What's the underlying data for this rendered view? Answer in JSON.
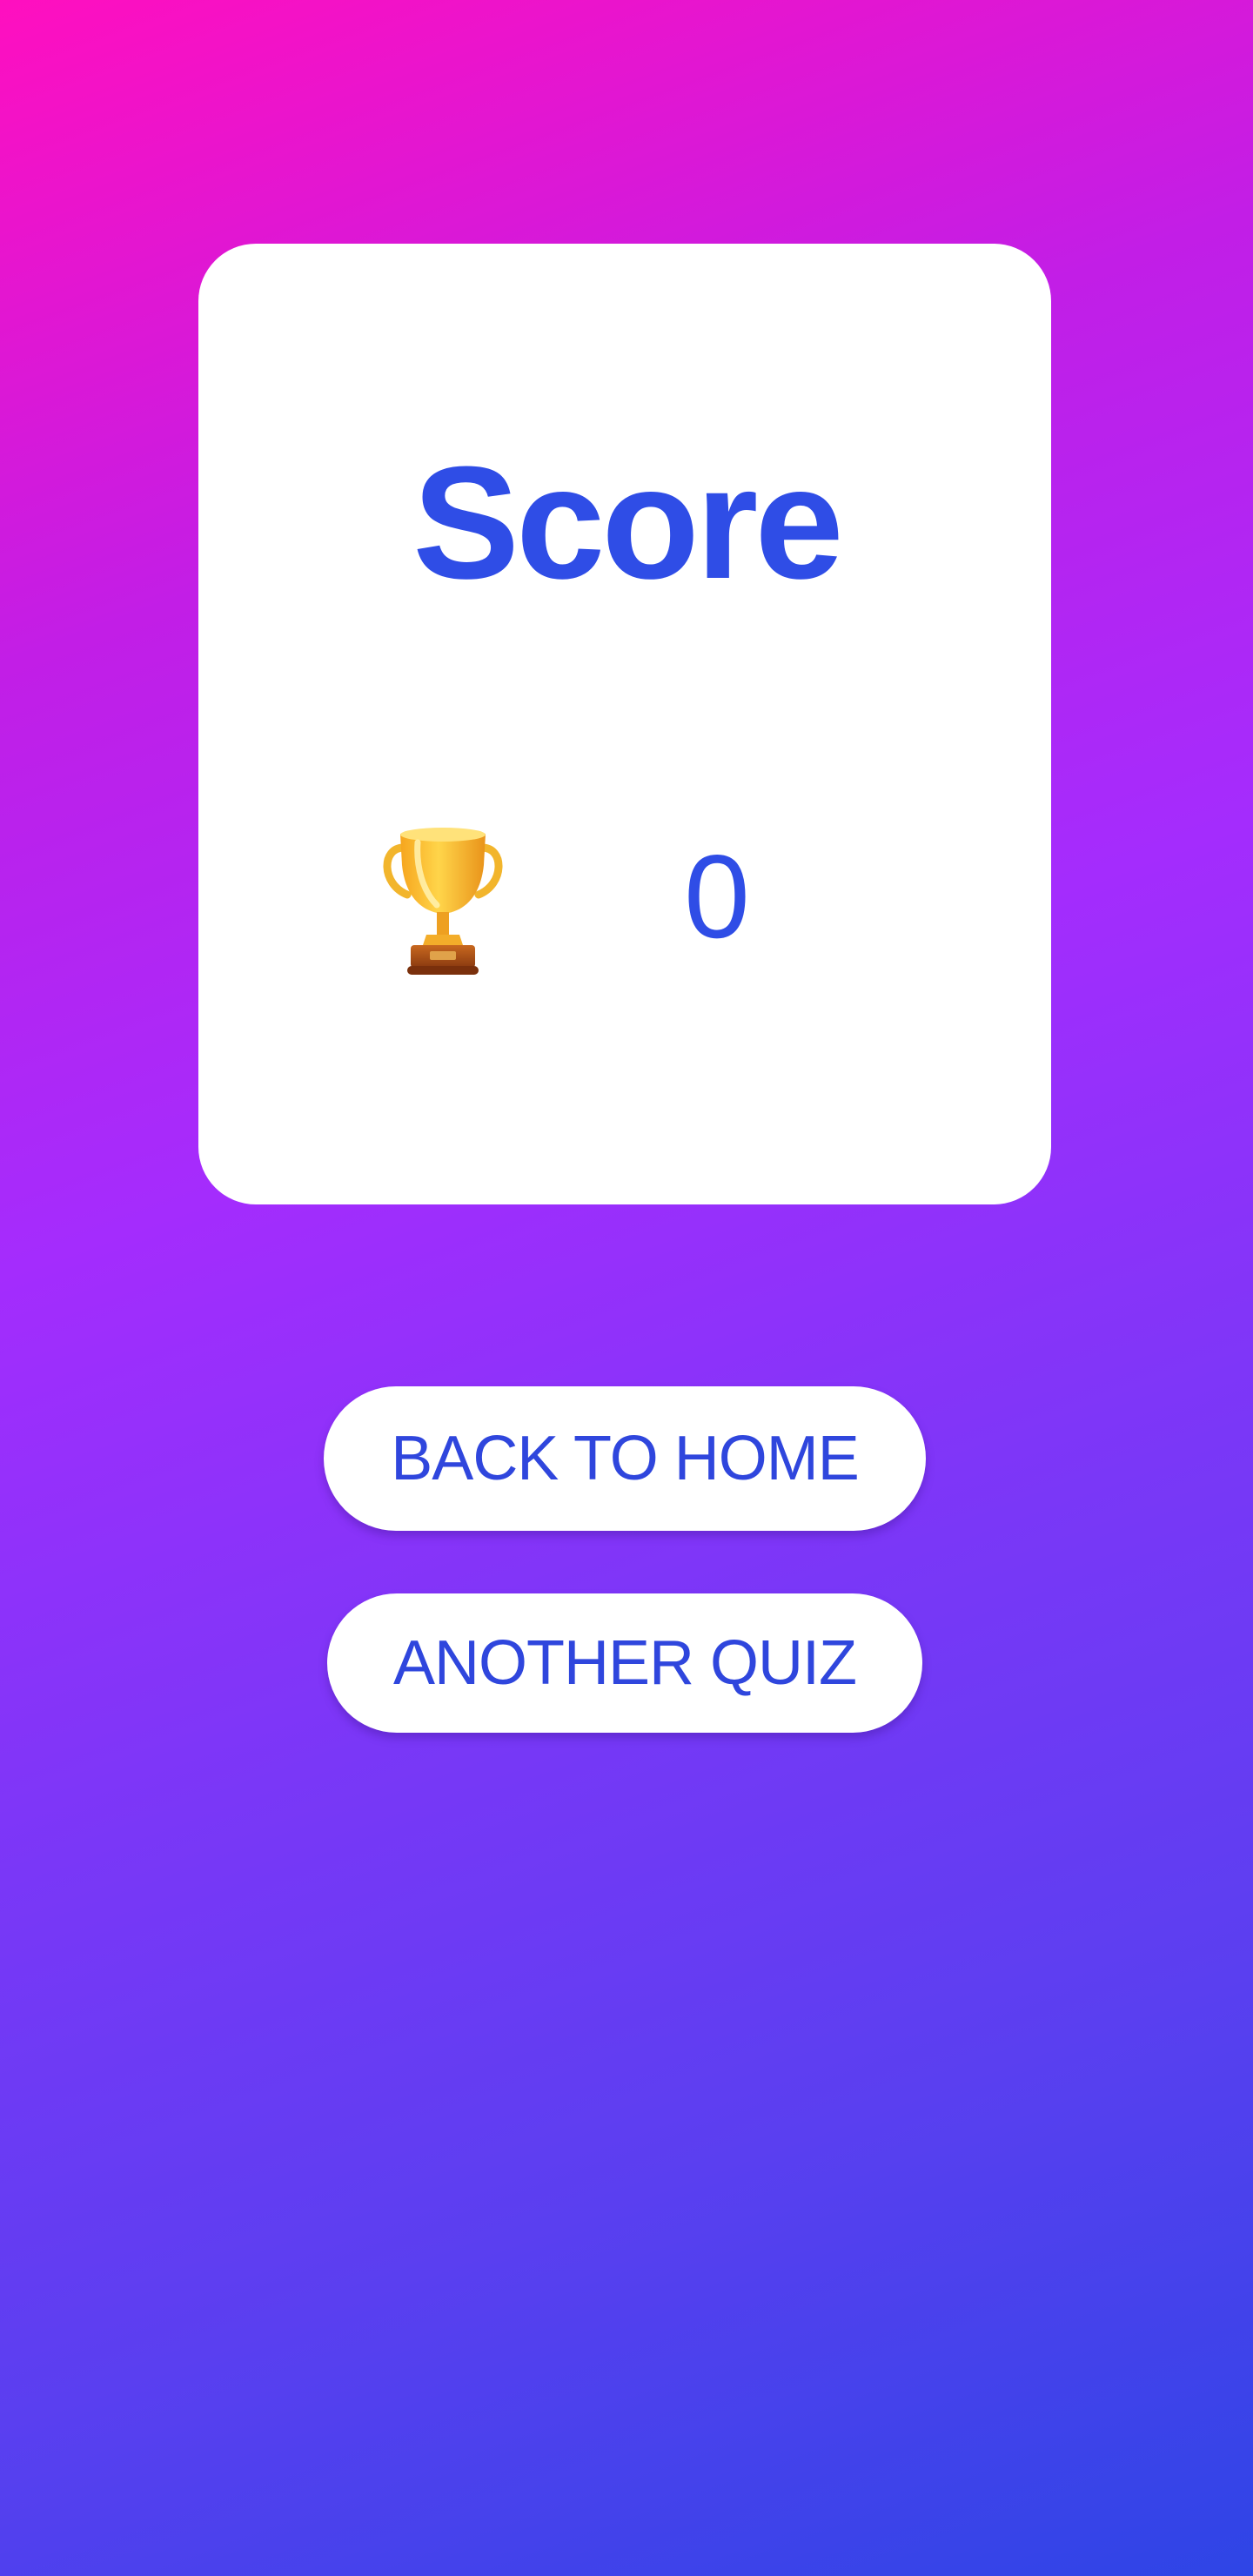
{
  "score_card": {
    "title": "Score",
    "trophy_icon": "trophy-icon",
    "value": "0"
  },
  "buttons": {
    "back_to_home": "BACK TO HOME",
    "another_quiz": "ANOTHER QUIZ"
  },
  "colors": {
    "accent_text": "#2f4de6",
    "card_background": "#ffffff",
    "gradient_top": "#ff0fbf",
    "gradient_middle": "#a42cfd",
    "gradient_bottom": "#2e45e6"
  }
}
